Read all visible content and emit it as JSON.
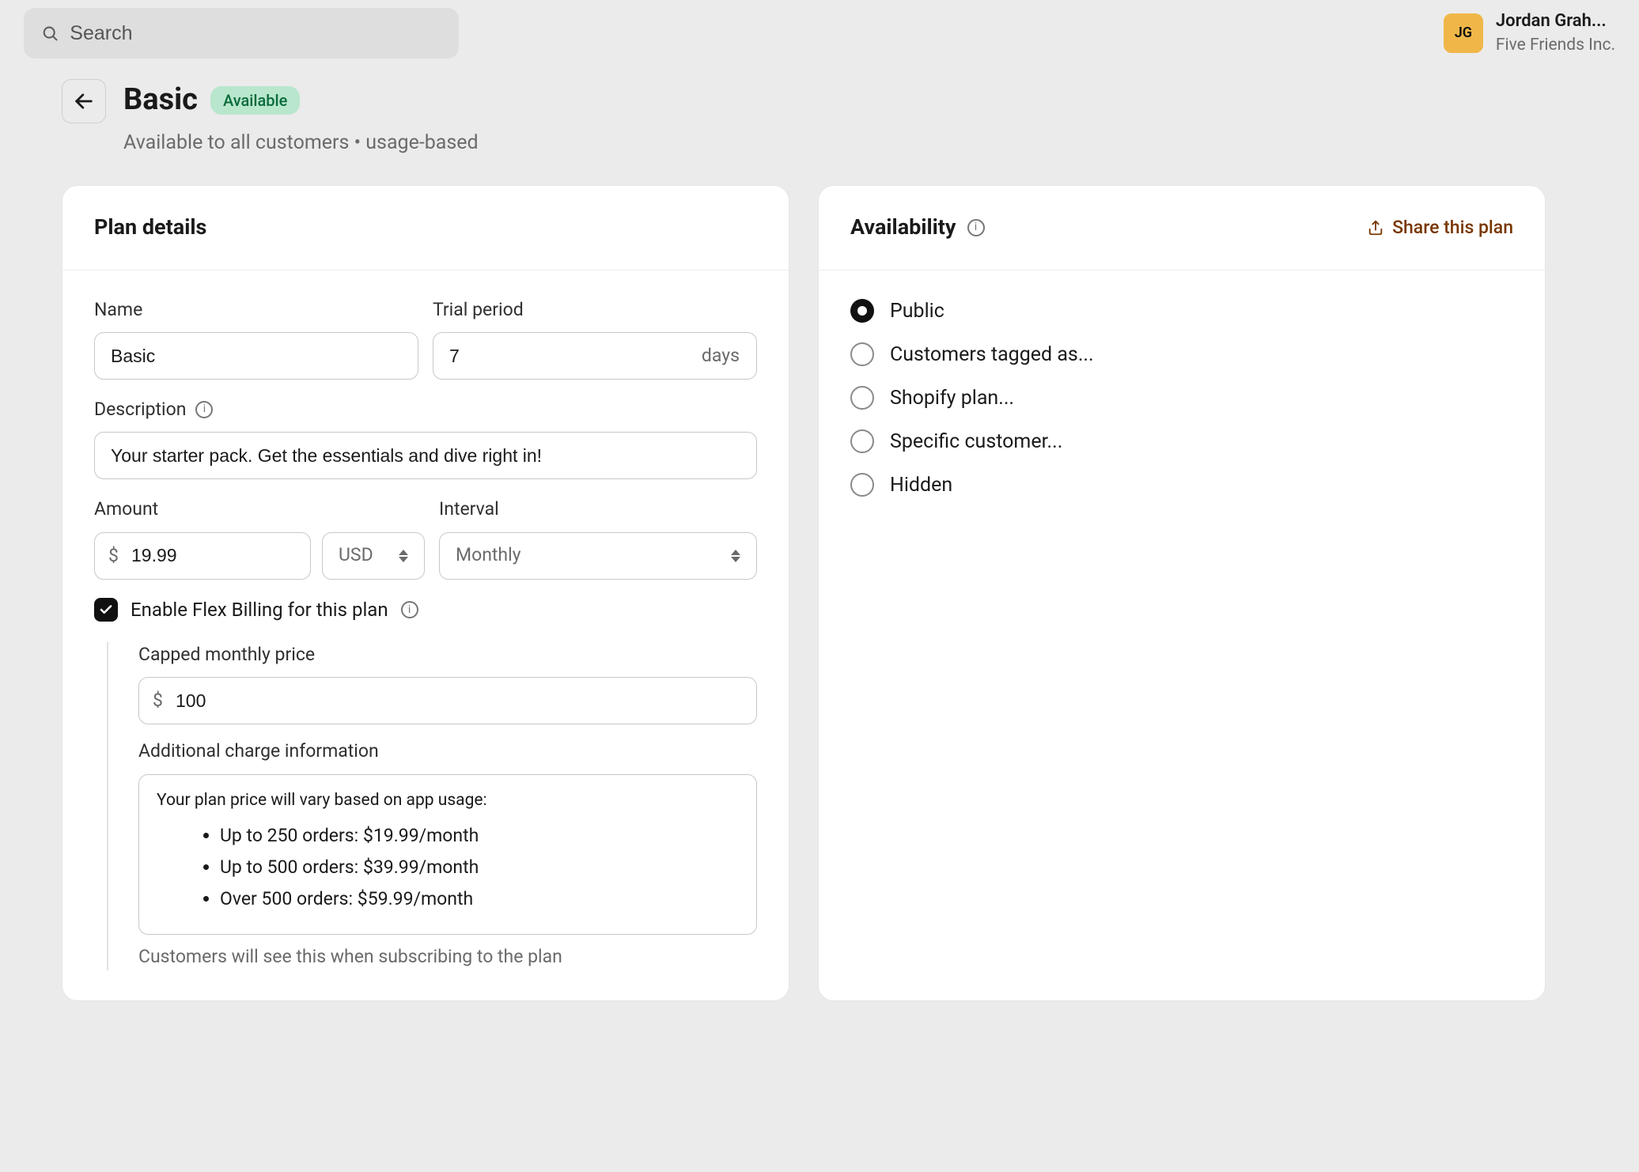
{
  "topbar": {
    "search_placeholder": "Search",
    "user": {
      "initials": "JG",
      "name": "Jordan Grah...",
      "org": "Five Friends Inc."
    }
  },
  "header": {
    "title": "Basic",
    "badge": "Available",
    "subtitle": "Available to all customers • usage-based"
  },
  "plan_details": {
    "title": "Plan details",
    "name_label": "Name",
    "name_value": "Basic",
    "trial_label": "Trial period",
    "trial_value": "7",
    "trial_unit": "days",
    "description_label": "Description",
    "description_value": "Your starter pack. Get the essentials and dive right in!",
    "amount_label": "Amount",
    "amount_currency_symbol": "$",
    "amount_value": "19.99",
    "currency_value": "USD",
    "interval_label": "Interval",
    "interval_value": "Monthly",
    "flex_label": "Enable Flex Billing for this plan",
    "flex_checked": true,
    "capped_label": "Capped monthly price",
    "capped_symbol": "$",
    "capped_value": "100",
    "additional_label": "Additional charge information",
    "additional_intro": "Your plan price will vary based on app usage:",
    "tiers": [
      "Up to 250 orders: $19.99/month",
      "Up to 500 orders: $39.99/month",
      "Over 500 orders: $59.99/month"
    ],
    "additional_hint": "Customers will see this when subscribing to the plan"
  },
  "availability": {
    "title": "Availability",
    "share_label": "Share this plan",
    "options": [
      {
        "label": "Public",
        "selected": true
      },
      {
        "label": "Customers tagged as...",
        "selected": false
      },
      {
        "label": "Shopify plan...",
        "selected": false
      },
      {
        "label": "Specific customer...",
        "selected": false
      },
      {
        "label": "Hidden",
        "selected": false
      }
    ]
  }
}
